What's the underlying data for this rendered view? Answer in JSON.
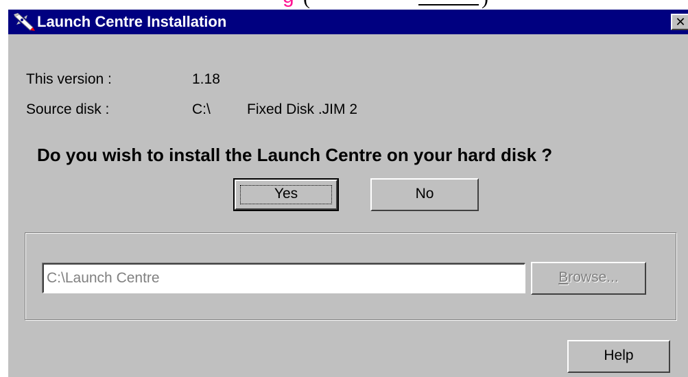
{
  "page_fragment": {
    "letter": "g",
    "paren_open": "(",
    "paren_close": ")"
  },
  "window": {
    "title": "Launch Centre Installation",
    "icon": "rocket-icon",
    "close_glyph": "✕",
    "titlebar_color": "#000080",
    "face_color": "#c0c0c0"
  },
  "info": {
    "version_label": "This version :",
    "version_value": "1.18",
    "source_label": "Source disk :",
    "source_drive": "C:\\",
    "source_name": "Fixed Disk .JIM 2"
  },
  "prompt": {
    "question": "Do you wish to install the Launch Centre on your hard disk ?",
    "yes_label": "Yes",
    "no_label": "No"
  },
  "install_path": {
    "value": "C:\\Launch Centre",
    "enabled": false,
    "browse_label": "Browse..."
  },
  "footer": {
    "help_label": "Help"
  }
}
